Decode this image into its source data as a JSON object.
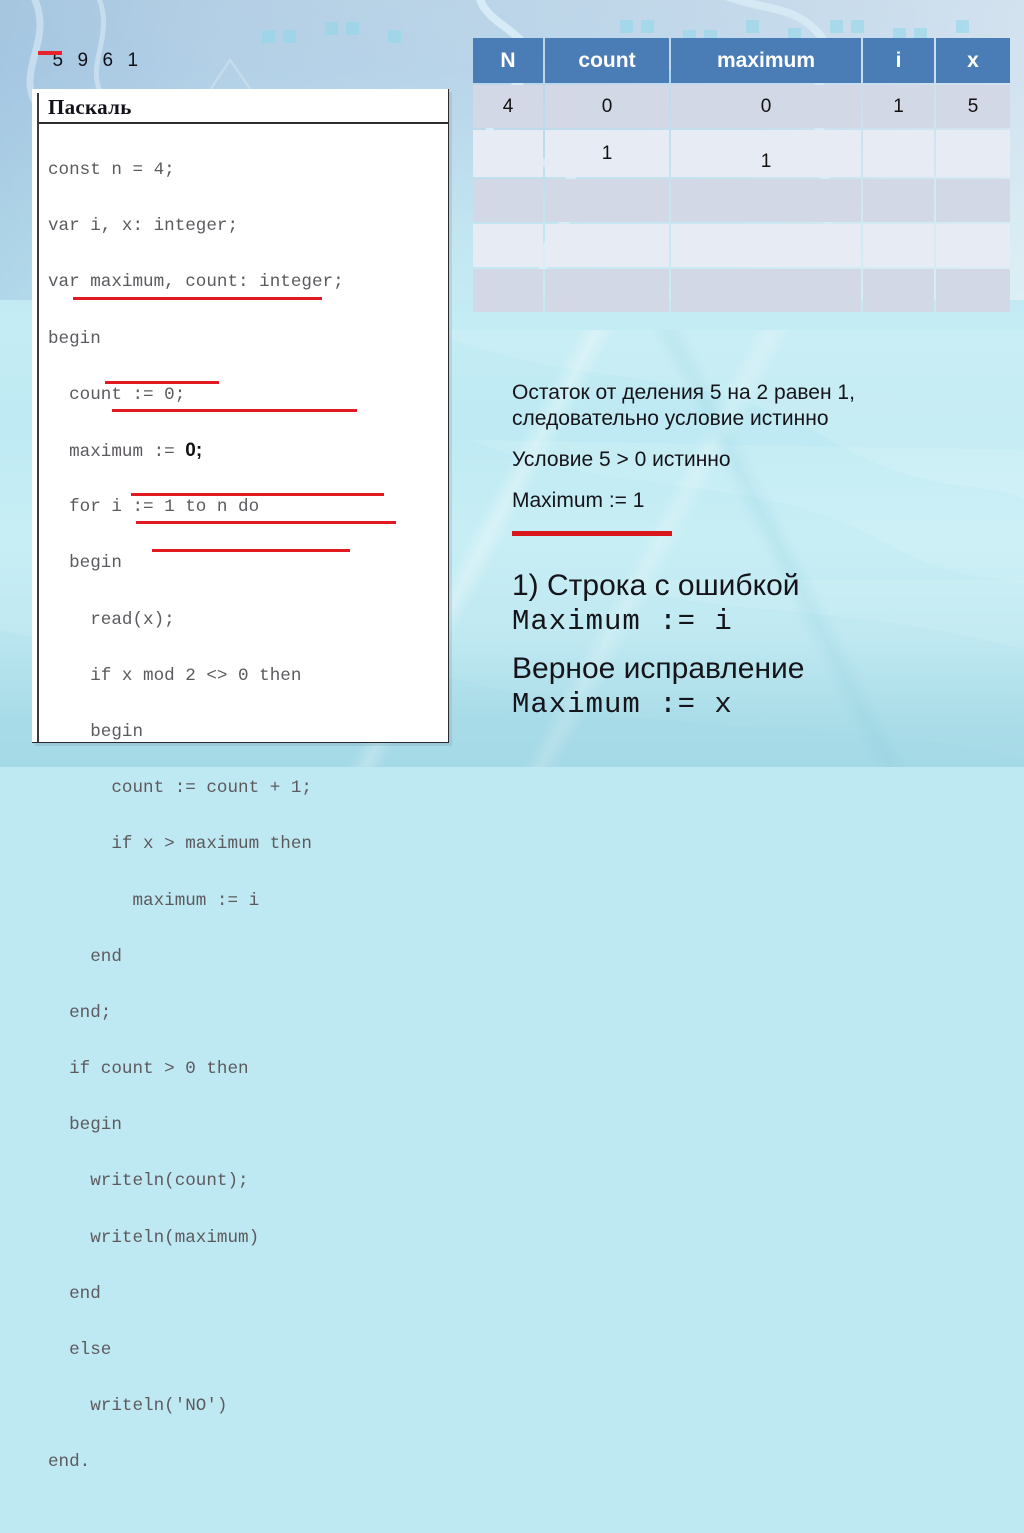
{
  "slide": {
    "top_numbers": [
      "5",
      "9",
      "6",
      "1"
    ],
    "top_numbers_underlined_index": 0,
    "accent_red": "#e01a20",
    "table_header_blue": "#4a7cb5",
    "row_color_a": "#d3d8e6",
    "row_color_b": "#e7ecf4",
    "background_colors": [
      "#b8cfe4",
      "#c4ecf4",
      "#a6dae6"
    ]
  },
  "code_panel": {
    "title": "Паскаль",
    "lines": [
      "const n = 4;",
      "var i, x: integer;",
      "var maximum, count: integer;",
      "begin",
      "  count := 0;",
      "  maximum := ",
      "  for i := 1 to n do",
      "  begin",
      "    read(x);",
      "    if x mod 2 <> 0 then",
      "    begin",
      "      count := count + 1;",
      "      if x > maximum then",
      "        maximum := i",
      "    end",
      "  end;",
      "  if count > 0 then",
      "  begin",
      "    writeln(count);",
      "    writeln(maximum)",
      "  end",
      "  else",
      "    writeln('NO')",
      "end."
    ],
    "annotation_zero": "0;",
    "underlined_lines": [
      "for i := 1 to n do",
      "read(x);",
      "if x mod 2 <> 0 then",
      "count := count + 1;",
      "if x > maximum then",
      "maximum := i"
    ]
  },
  "trace_table": {
    "headers": [
      "N",
      "count",
      "maximum",
      "i",
      "x"
    ],
    "rows": [
      [
        "4",
        "0",
        "0",
        "1",
        "5"
      ],
      [
        "",
        "1",
        "1",
        "",
        ""
      ],
      [
        "",
        "",
        "",
        "",
        ""
      ],
      [
        "",
        "",
        "",
        "",
        ""
      ],
      [
        "",
        "",
        "",
        "",
        ""
      ]
    ]
  },
  "explanation": {
    "line1": "Остаток от деления 5 на 2 равен 1,",
    "line2": "следовательно условие истинно",
    "line3": "Условие  5 > 0 истинно",
    "line4": "Maximum := 1"
  },
  "conclusion": {
    "error_heading": "1) Строка с ошибкой",
    "error_code": "Maximum := i",
    "fix_heading": "Верное исправление",
    "fix_code": "Maximum := x"
  }
}
